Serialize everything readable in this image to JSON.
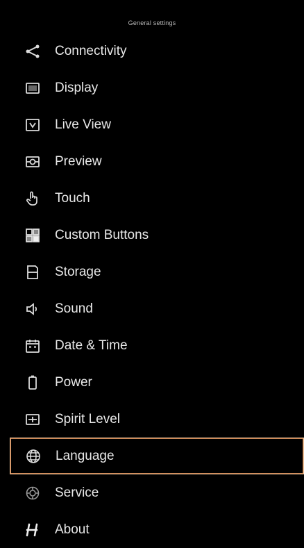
{
  "header": {
    "title": "General settings"
  },
  "menu": {
    "items": [
      {
        "label": "Connectivity",
        "icon": "share-icon"
      },
      {
        "label": "Display",
        "icon": "display-icon"
      },
      {
        "label": "Live View",
        "icon": "live-view-icon"
      },
      {
        "label": "Preview",
        "icon": "preview-icon"
      },
      {
        "label": "Touch",
        "icon": "touch-hand-icon"
      },
      {
        "label": "Custom Buttons",
        "icon": "custom-buttons-icon"
      },
      {
        "label": "Storage",
        "icon": "storage-icon"
      },
      {
        "label": "Sound",
        "icon": "speaker-icon"
      },
      {
        "label": "Date & Time",
        "icon": "calendar-icon"
      },
      {
        "label": "Power",
        "icon": "battery-icon"
      },
      {
        "label": "Spirit Level",
        "icon": "spirit-level-icon"
      },
      {
        "label": "Language",
        "icon": "globe-icon",
        "selected": true
      },
      {
        "label": "Service",
        "icon": "service-icon"
      },
      {
        "label": "About",
        "icon": "brand-logo-icon"
      }
    ]
  },
  "colors": {
    "background": "#000000",
    "text": "#e8e8e8",
    "selected_border": "#f2c8a0",
    "selected_border_inner": "#c87f4b"
  }
}
